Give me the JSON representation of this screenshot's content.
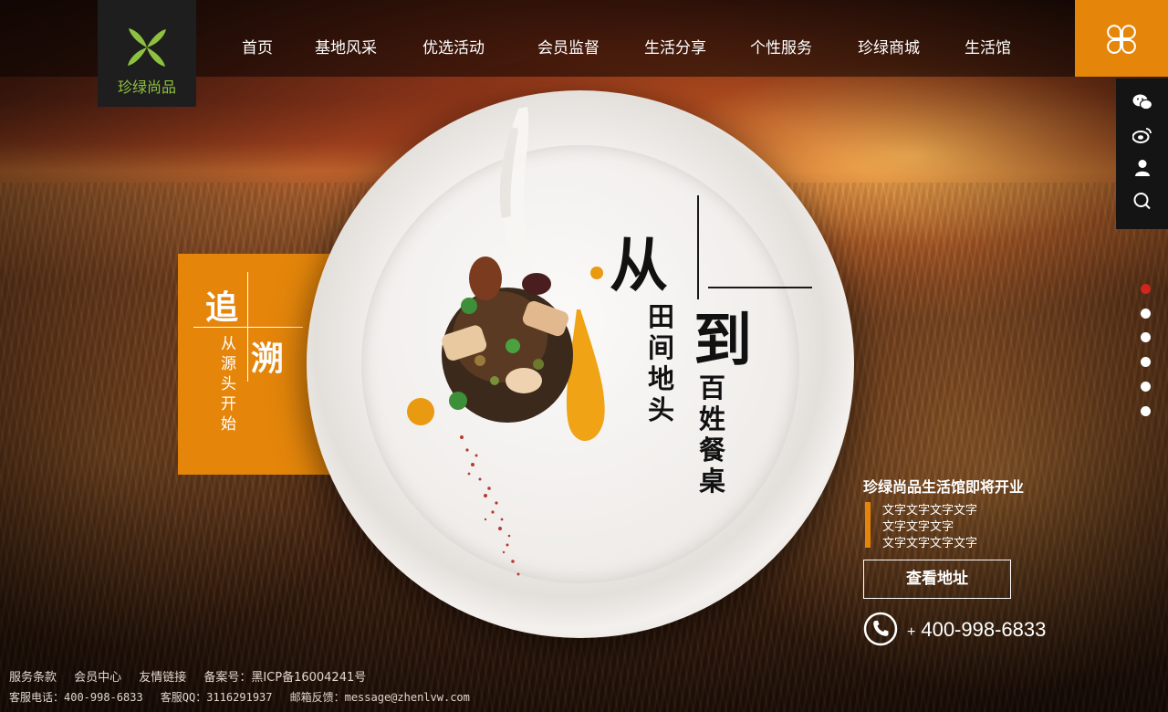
{
  "logo": {
    "text": "珍绿尚品",
    "icon": "clover-icon"
  },
  "nav": {
    "items": [
      {
        "label": "首页"
      },
      {
        "label": "基地风采"
      },
      {
        "label": "优选活动"
      },
      {
        "label": "会员监督"
      },
      {
        "label": "生活分享"
      },
      {
        "label": "个性服务"
      },
      {
        "label": "珍绿商城"
      },
      {
        "label": "生活馆"
      }
    ],
    "brand_button_icon": "four-leaf-icon"
  },
  "side_tools": [
    "wechat-icon",
    "weibo-icon",
    "user-icon",
    "search-icon"
  ],
  "slider": {
    "count": 6,
    "active_index": 1
  },
  "hero": {
    "trace": {
      "char1": "追",
      "char2": "溯",
      "sub": "从源头开始"
    },
    "calligraphy": {
      "char_from": "从",
      "char_to": "到",
      "col1": "田间地头",
      "col2": "百姓餐桌"
    }
  },
  "info": {
    "title": "珍绿尚品生活馆即将开业",
    "lines": [
      "文字文字文字文字",
      "文字文字文字",
      "文字文字文字文字"
    ],
    "address_button": "查看地址",
    "phone_prefix": "+",
    "phone": "400-998-6833"
  },
  "footer": {
    "links": [
      "服务条款",
      "会员中心",
      "友情链接"
    ],
    "icp": "备案号：黑ICP备16004241号",
    "service_phone": "客服电话：400-998-6833",
    "service_qq": "客服QQ：3116291937",
    "email": "邮箱反馈：message@zhenlvw.com"
  },
  "colors": {
    "accent": "#e5860b",
    "logo_green": "#8dc23f",
    "dot_active": "#d0261d"
  }
}
